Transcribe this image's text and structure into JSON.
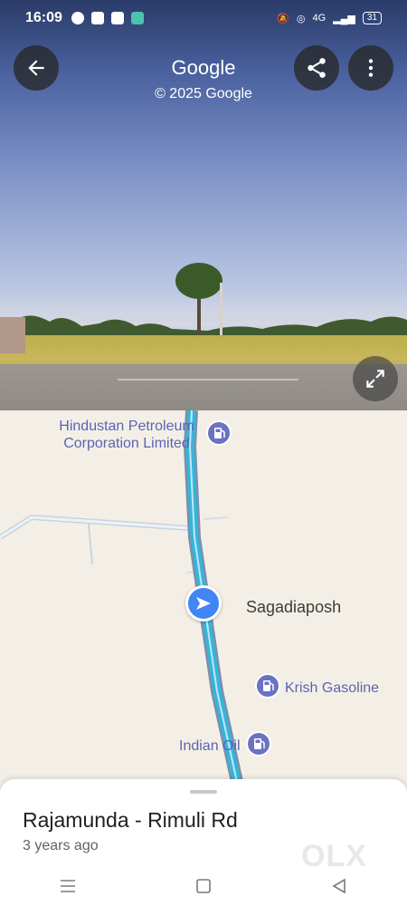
{
  "status_bar": {
    "time": "16:09",
    "battery": "31",
    "network": "4G"
  },
  "header": {
    "title": "Google",
    "copyright": "© 2025 Google"
  },
  "icons": {
    "back": "arrow-left",
    "share": "share-nodes",
    "more": "three-dots-vertical",
    "expand": "arrows-diagonal-expand",
    "fuel": "gas-station",
    "location": "navigation-arrow"
  },
  "map": {
    "pois": [
      {
        "name": "Hindustan Petroleum Corporation Limited",
        "line1": "Hindustan Petroleum",
        "line2": "Corporation Limited"
      },
      {
        "name": "Krish Gasoline"
      },
      {
        "name": "Indian Oil"
      }
    ],
    "place": "Sagadiaposh"
  },
  "sheet": {
    "road_name": "Rajamunda - Rimuli Rd",
    "age": "3 years ago",
    "watermark": "OLX"
  },
  "colors": {
    "route": "#34b6d9",
    "poi": "#5b63b6",
    "location_dot": "#4285f4"
  }
}
